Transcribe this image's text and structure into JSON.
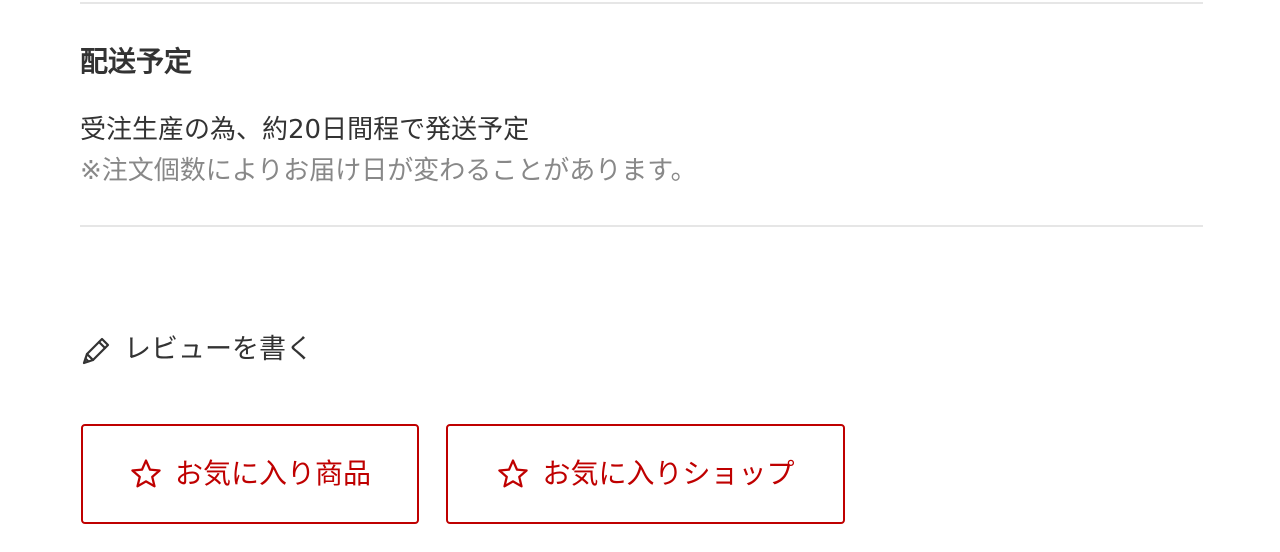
{
  "shipping": {
    "heading": "配送予定",
    "main": "受注生産の為、約20日間程で発送予定",
    "note": "※注文個数によりお届け日が変わることがあります。"
  },
  "review": {
    "icon": "pencil-icon",
    "label": "レビューを書く"
  },
  "favorites": {
    "icon": "star-outline-icon",
    "item_label": "お気に入り商品",
    "shop_label": "お気に入りショップ",
    "accent_color": "#bf0000"
  }
}
